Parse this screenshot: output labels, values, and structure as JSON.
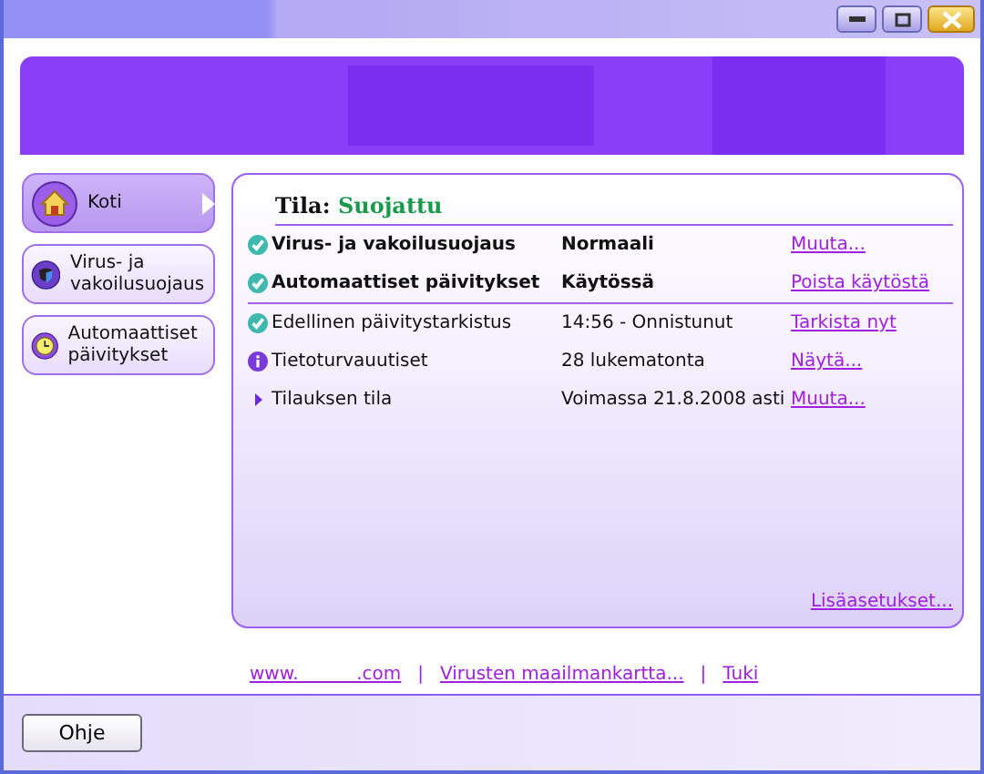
{
  "nav": [
    {
      "label": "Koti",
      "selected": true
    },
    {
      "label": "Virus- ja vakoilusuojaus",
      "selected": false
    },
    {
      "label": "Automaattiset päivitykset",
      "selected": false
    }
  ],
  "status": {
    "label": "Tila:",
    "value": "Suojattu"
  },
  "rows": [
    {
      "kind": "check",
      "bold": true,
      "name": "Virus- ja vakoilusuojaus",
      "value": "Normaali",
      "link": "Muuta..."
    },
    {
      "kind": "check",
      "bold": true,
      "name": "Automaattiset päivitykset",
      "value": "Käytössä",
      "link": "Poista käytöstä"
    },
    {
      "kind": "check",
      "bold": false,
      "name": "Edellinen päivitystarkistus",
      "value": "14:56 - Onnistunut",
      "link": "Tarkista nyt"
    },
    {
      "kind": "info",
      "bold": false,
      "name": "Tietoturvauutiset",
      "value": "28 lukematonta",
      "link": "Näytä..."
    },
    {
      "kind": "arrow",
      "bold": false,
      "name": "Tilauksen tila",
      "value": "Voimassa 21.8.2008 asti",
      "link": "Muuta..."
    }
  ],
  "more_link": "Lisäasetukset...",
  "footer_links": [
    "www.          .com",
    "Virusten maailmankartta...",
    "Tuki"
  ],
  "footer_separators": [
    "|",
    "|"
  ],
  "help_button": "Ohje"
}
